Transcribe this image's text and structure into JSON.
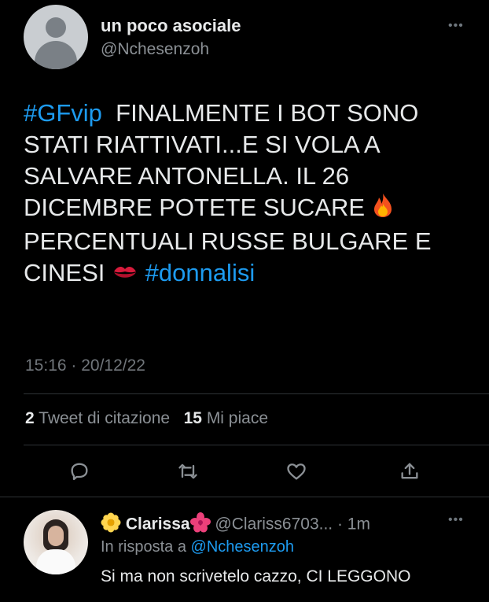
{
  "tweet": {
    "display_name": "un poco asociale",
    "handle": "@Nchesenzoh",
    "more_label": "•••",
    "text_parts": {
      "hashtag1": "#GFvip",
      "line1": "FINALMENTE I BOT SONO",
      "line2": "STATI RIATTIVATI...E SI VOLA A",
      "line3": "SALVARE ANTONELLA. IL 26",
      "line4": "DICEMBRE POTETE SUCARE",
      "line5": "PERCENTUALI RUSSE BULGARE E",
      "line6": "CINESI",
      "hashtag2": "#donnalisi"
    },
    "emojis": {
      "fire": "fire-emoji",
      "kiss": "kiss-mark-emoji"
    },
    "timestamp": "15:16 · 20/12/22",
    "stats": {
      "quote_count": "2",
      "quote_label": "Tweet di citazione",
      "like_count": "15",
      "like_label": "Mi piace"
    },
    "actions": [
      "reply-icon",
      "retweet-icon",
      "like-icon",
      "share-icon"
    ]
  },
  "reply": {
    "name": "Clarissa",
    "name_emoji": "flower-emoji",
    "handle": "@Clariss6703...",
    "time": "· 1m",
    "more_label": "•••",
    "in_reply_label": "In risposta a",
    "in_reply_handle": "@Nchesenzoh",
    "text": "Si ma non scrivetelo cazzo, CI LEGGONO"
  },
  "colors": {
    "background": "#000000",
    "text": "#e7e9ea",
    "secondary": "#71767b",
    "accent": "#1d9bf0"
  }
}
